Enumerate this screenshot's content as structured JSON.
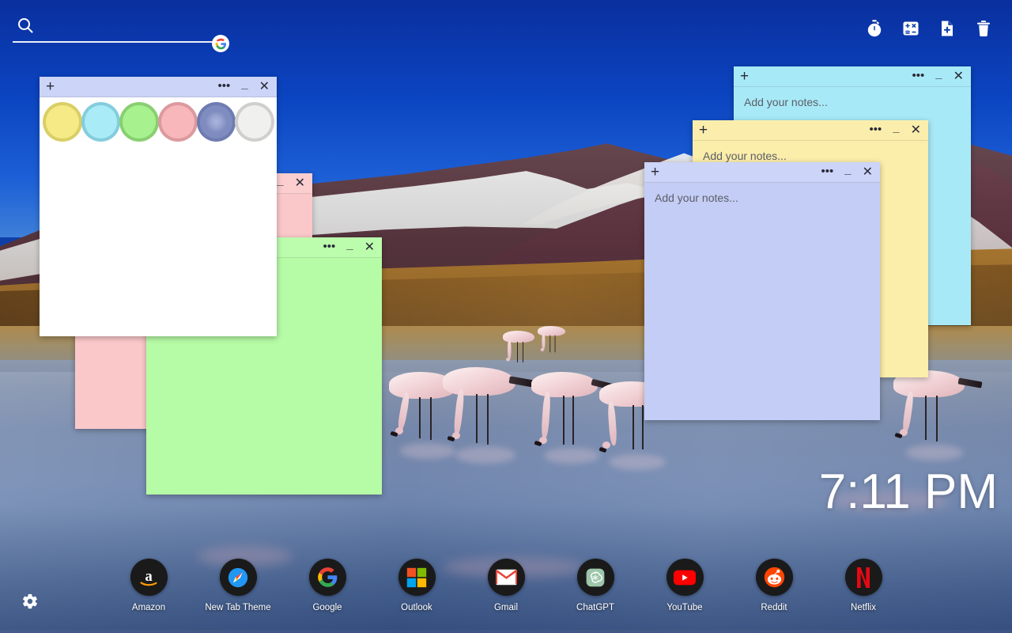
{
  "search": {
    "placeholder": "",
    "value": "",
    "icon": "search-icon",
    "brand_icon": "google-g-logo"
  },
  "toolbar": {
    "items": [
      {
        "name": "timer-icon",
        "label": "Timer"
      },
      {
        "name": "calculator-icon",
        "label": "Calculator"
      },
      {
        "name": "new-note-icon",
        "label": "New Note"
      },
      {
        "name": "trash-icon",
        "label": "Trash"
      }
    ]
  },
  "window_controls": {
    "add": "+",
    "more": "•••",
    "minimize": "_",
    "close": "✕"
  },
  "notes": {
    "placeholder": "Add your notes...",
    "windows": [
      {
        "id": "cyan",
        "color": "#a8e9f7",
        "text": "Add your notes..."
      },
      {
        "id": "yellow",
        "color": "#fbedaa",
        "text": "Add your notes..."
      },
      {
        "id": "purple",
        "color": "#c3cdf5",
        "text": "Add your notes..."
      },
      {
        "id": "pink",
        "color": "#fbc8ca",
        "text": ""
      },
      {
        "id": "green",
        "color": "#b6fba6",
        "text": ""
      },
      {
        "id": "white",
        "color": "#ffffff",
        "text": ""
      }
    ]
  },
  "color_picker": {
    "swatches": [
      {
        "name": "color-yellow",
        "color": "#f6ea86",
        "ring": "#d9cf66",
        "selected": false
      },
      {
        "name": "color-cyan",
        "color": "#a9ebf7",
        "ring": "#84cddd",
        "selected": false
      },
      {
        "name": "color-green",
        "color": "#a7f28f",
        "ring": "#89cf72",
        "selected": false
      },
      {
        "name": "color-pink",
        "color": "#f8b8bb",
        "ring": "#dc9a9e",
        "selected": false
      },
      {
        "name": "color-purple",
        "color": "#7e8cc0",
        "ring": "#6f7cb2",
        "selected": true
      },
      {
        "name": "color-white",
        "color": "#f0f0ef",
        "ring": "#cfcfcd",
        "selected": false
      }
    ]
  },
  "clock": {
    "time": "7:11 PM"
  },
  "dock": {
    "items": [
      {
        "name": "amazon",
        "label": "Amazon"
      },
      {
        "name": "new-tab-theme",
        "label": "New Tab Theme"
      },
      {
        "name": "google",
        "label": "Google"
      },
      {
        "name": "outlook",
        "label": "Outlook"
      },
      {
        "name": "gmail",
        "label": "Gmail"
      },
      {
        "name": "chatgpt",
        "label": "ChatGPT"
      },
      {
        "name": "youtube",
        "label": "YouTube"
      },
      {
        "name": "reddit",
        "label": "Reddit"
      },
      {
        "name": "netflix",
        "label": "Netflix"
      }
    ]
  },
  "settings": {
    "icon": "gear-icon",
    "label": "Settings"
  },
  "theme": {
    "accent": "#0e3fa8",
    "wallpaper_description": "Snow-capped mountains over an altiplano lagoon with flamingos"
  }
}
